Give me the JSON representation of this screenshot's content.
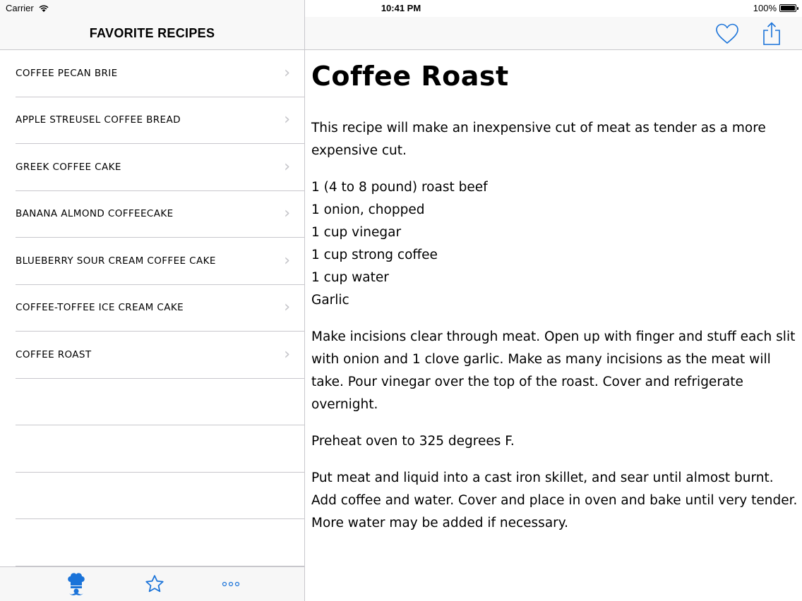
{
  "status": {
    "carrier": "Carrier",
    "time": "10:41 PM",
    "battery": "100%",
    "battery_level": 1.0
  },
  "master": {
    "title": "FAVORITE RECIPES",
    "items": [
      {
        "label": "COFFEE PECAN BRIE"
      },
      {
        "label": "APPLE STREUSEL COFFEE BREAD"
      },
      {
        "label": "GREEK COFFEE CAKE"
      },
      {
        "label": "BANANA ALMOND COFFEECAKE"
      },
      {
        "label": "BLUEBERRY SOUR CREAM COFFEE CAKE"
      },
      {
        "label": "COFFEE-TOFFEE ICE CREAM CAKE"
      },
      {
        "label": "COFFEE ROAST"
      }
    ],
    "chevron": "›"
  },
  "tabbar": {
    "tabs": [
      {
        "icon": "chef-icon",
        "selected": true
      },
      {
        "icon": "star-icon",
        "selected": false
      },
      {
        "icon": "more-icon",
        "selected": false
      }
    ]
  },
  "detail": {
    "actions": [
      {
        "icon": "heart-icon"
      },
      {
        "icon": "share-icon"
      }
    ],
    "title": "Coffee Roast",
    "intro": "This recipe will make an inexpensive cut of meat as tender as a more expensive cut.",
    "ingredients": [
      "1 (4 to 8 pound) roast beef",
      "1 onion, chopped",
      "1 cup vinegar",
      "1 cup strong coffee",
      "1 cup water",
      "Garlic"
    ],
    "steps": [
      "Make incisions clear through meat. Open up with finger and stuff each slit with onion and 1 clove garlic. Make as many incisions as the meat will take. Pour vinegar over the top of the roast. Cover and refrigerate overnight.",
      "Preheat oven to 325 degrees F.",
      "Put meat and liquid into a cast iron skillet, and sear until almost burnt. Add coffee and water. Cover and place in oven and bake until very tender. More water may be added if necessary."
    ]
  },
  "colors": {
    "tint": "#1a73d9",
    "separator": "#c8c7cc",
    "chevron": "#c4c4c9"
  }
}
